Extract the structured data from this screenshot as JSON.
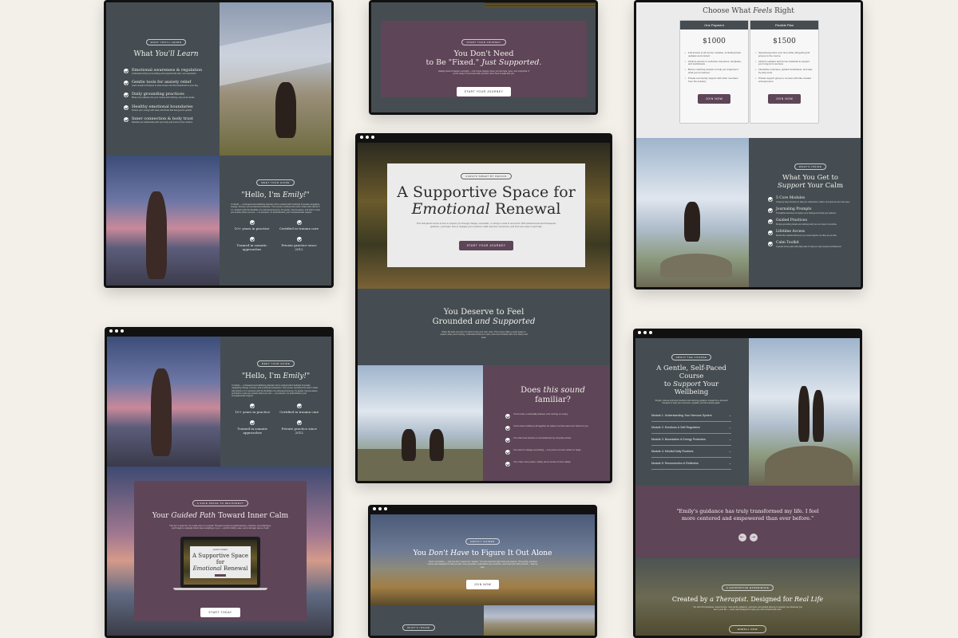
{
  "frame_a": {
    "learn_pill": "What You'll Learn",
    "learn_title_pre": "What ",
    "learn_title_italic": "You'll Learn",
    "learn_items": [
      {
        "title": "Emotional awareness & regulation",
        "desc": "Understand what you're feeling and respond with calm, not overwhelm."
      },
      {
        "title": "Gentle tools for anxiety relief",
        "desc": "Learn simple techniques to ease tension and find steadiness in your day."
      },
      {
        "title": "Daily grounding practices",
        "desc": "Bring more stillness into your routine with calming, easy-to-do rituals."
      },
      {
        "title": "Healthy emotional boundaries",
        "desc": "Protect your energy with clear, kind limits that feel good to uphold."
      },
      {
        "title": "Inner connection & body trust",
        "desc": "Rebuild your relationship with your body and trust its inner wisdom."
      }
    ],
    "meet_pill": "Meet Your Guide",
    "hello_pre": "\"Hello, I'm ",
    "hello_name": "Emily!",
    "hello_post": "\"",
    "bio": "I'm Emily — a therapist and wellbeing educator who's worked with hundreds of people navigating change, burnout, and emotional exhaustion. This course combines the tools I share with clients in 1:1 sessions with the flexibility of a self-paced journey. It's gentle, trauma-aware, and built to meet you exactly where you are — no pressure, no perfectionism, just compassionate support.",
    "stats": [
      "10+ years in practice",
      "Certified in trauma care",
      "Trained in somatic approaches",
      "Private practice since 2012"
    ]
  },
  "frame_b": {
    "pill": "Start Your Journey",
    "title_line1": "You Don't Need",
    "title_line2_pre": "to Be \"Fixed.\" ",
    "title_line2_italic": "Just Supported.",
    "body": "Healing doesn't happen overnight — but it does happen when you feel safe, seen, and supported. If you're ready to reconnect with yourself, we're here to walk with you.",
    "button": "Start Your Journey"
  },
  "frame_c": {
    "pricing_title_pre": "Choose What ",
    "pricing_title_italic": "Feels",
    "pricing_title_post": " Right",
    "plans": [
      {
        "name": "One Payment",
        "price": "$1000",
        "features": [
          "Full access to all course modules, including future updates and content",
          "Lifetime access to exclusive resources, templates, and worksheets",
          "Bonus coaching session to help you implement what you've learned",
          "Private community support with other members from the industry"
        ],
        "button": "Join Now"
      },
      {
        "name": "Flexible Plan",
        "price": "$1500",
        "features": [
          "Spread payments over time while still getting full access to the course",
          "Lifetime updates and bonus materials to support your long-term success",
          "Interactive exercises, guided worksheets, and step-by-step tools",
          "Private support group to connect with like-minded entrepreneurs"
        ],
        "button": "Join Now"
      }
    ],
    "pill": "What's Inside",
    "get_title_pre": "What You Get to",
    "get_title_italic": "Support",
    "get_title_post": " Your Calm",
    "get_items": [
      {
        "title": "5 Core Modules",
        "desc": "A step-by-step structure to help you understand, reflect, and grow at your own pace."
      },
      {
        "title": "Journaling Prompts",
        "desc": "Thoughtful exercises to explore your feelings and heal your patterns."
      },
      {
        "title": "Guided Practices",
        "desc": "Simple grounding rituals and calming tools you can return to anytime."
      },
      {
        "title": "Lifetime Access",
        "desc": "Revisit the material whenever you need support, as often as you like."
      },
      {
        "title": "Calm Toolkit",
        "desc": "A gentle bonus pack with daily tools to help you stay steady and balanced."
      }
    ]
  },
  "frame_d": {
    "hero_pill": "Always Sweet by Design",
    "hero_title_line1": "A Supportive Space for",
    "hero_title_italic": "Emotional",
    "hero_title_post": " Renewal",
    "hero_body": "This self-paced course is here to support you through change, overwhelm, or simply a need to reconnect. With practical tools and therapeutic guidance, you'll learn how to navigate your emotions, build real inner connection, and find more ease in each day.",
    "hero_button": "Start Your Journey",
    "deserve_title_line1": "You Deserve to Feel",
    "deserve_title_pre": "Grounded ",
    "deserve_title_italic": "and Supported",
    "deserve_body": "When life feels too loud, it's hard to hear your own voice. This course offers a quiet space to explore what you're feeling, understand what you need, and move forward with more clarity and ease.",
    "does_title_pre": "Does ",
    "does_title_italic": "this sound",
    "does_title_post": "familiar?",
    "does_items": [
      "You're tired, emotionally drained, and running on empty",
      "You're done holding it all together for others, but the same isn't there for you",
      "You often feel anxious or overwhelmed by everyday stress",
      "You want to change something — but you're not sure where to begin",
      "You crave more peace, clarity, and a sense of inner safety"
    ]
  },
  "frame_e": {
    "meet_pill": "Meet Your Guide",
    "hello_pre": "\"Hello, I'm ",
    "hello_name": "Emily!",
    "hello_post": "\"",
    "bio": "I'm Emily — a therapist and wellbeing educator who's worked with hundreds of people navigating change, burnout, and emotional exhaustion. This course combines the tools I share with clients in 1:1 sessions with the flexibility of a self-paced journey. It's gentle, trauma-aware, and built to meet you exactly where you are — no pressure, no perfectionism, just compassionate support.",
    "stats": [
      "10+ years in practice",
      "Certified in trauma care",
      "Trained in somatic approaches",
      "Private practice since 2012"
    ],
    "path_pill": "A Safe Space to Reconnect",
    "path_title_pre": "Your ",
    "path_title_italic": "Guided Path",
    "path_title_post": " Toward Inner Calm",
    "path_body": "This isn't a quick fix. It's a safe return to yourself. Through a series of guided lessons, practices, and reflections, you'll begin to untangle what's been weighing on you — and find clarity, ease, and a stronger sense of self.",
    "laptop_pill": "Always Sweet",
    "laptop_title_line1": "A Supportive Space for",
    "laptop_title_italic": "Emotional",
    "laptop_title_post": " Renewal",
    "button": "Start Today"
  },
  "frame_f": {
    "pill": "Gently Guided",
    "title_pre": "You ",
    "title_italic": "Don't Have",
    "title_post": " to Figure It Out Alone",
    "body": "You're not broken — and you don't need to be \"healed.\" You just need the right tools and support. This gentle, practical course was designed to help you feel more grounded, understand your emotions, and reconnect with yourself — step by step.",
    "button": "Join Now",
    "bottom_pill": "What's Inside"
  },
  "frame_g": {
    "pill": "About the Course",
    "title_line1": "A Gentle, Self-Paced Course",
    "title_pre": "to ",
    "title_italic": "Support",
    "title_post": " Your Wellbeing",
    "body": "Simple, trauma-informed practices and calming guidance created by a licensed therapist to help you reconnect, regulate, and feel steady again.",
    "modules": [
      "Module 1: Understanding Your Nervous System",
      "Module 2: Emotions & Self-Regulation",
      "Module 3: Boundaries & Energy Protection",
      "Module 4: Mindful Daily Routines",
      "Module 5: Reconnection & Reflection"
    ],
    "quote": "\"Emily's guidance has truly transformed my life. I feel more centered and empowered than ever before.\"",
    "quote_prev": "←",
    "quote_next": "→",
    "created_pill": "A Supportive Experience",
    "created_title_pre": "Created by ",
    "created_title_italic1": "a Therapist",
    "created_title_mid": ". Designed for ",
    "created_title_italic2": "Real Life",
    "created_body": "You don't find practices, lessons here. Just gentle guidance, real tools, and guided lessons to support you wherever you are in your life — every step designed to help you move forward with care.",
    "created_button": "Enroll Now"
  },
  "colors": {
    "slate": "#454d52",
    "plum": "#5e4558",
    "background": "#f3efe9"
  }
}
